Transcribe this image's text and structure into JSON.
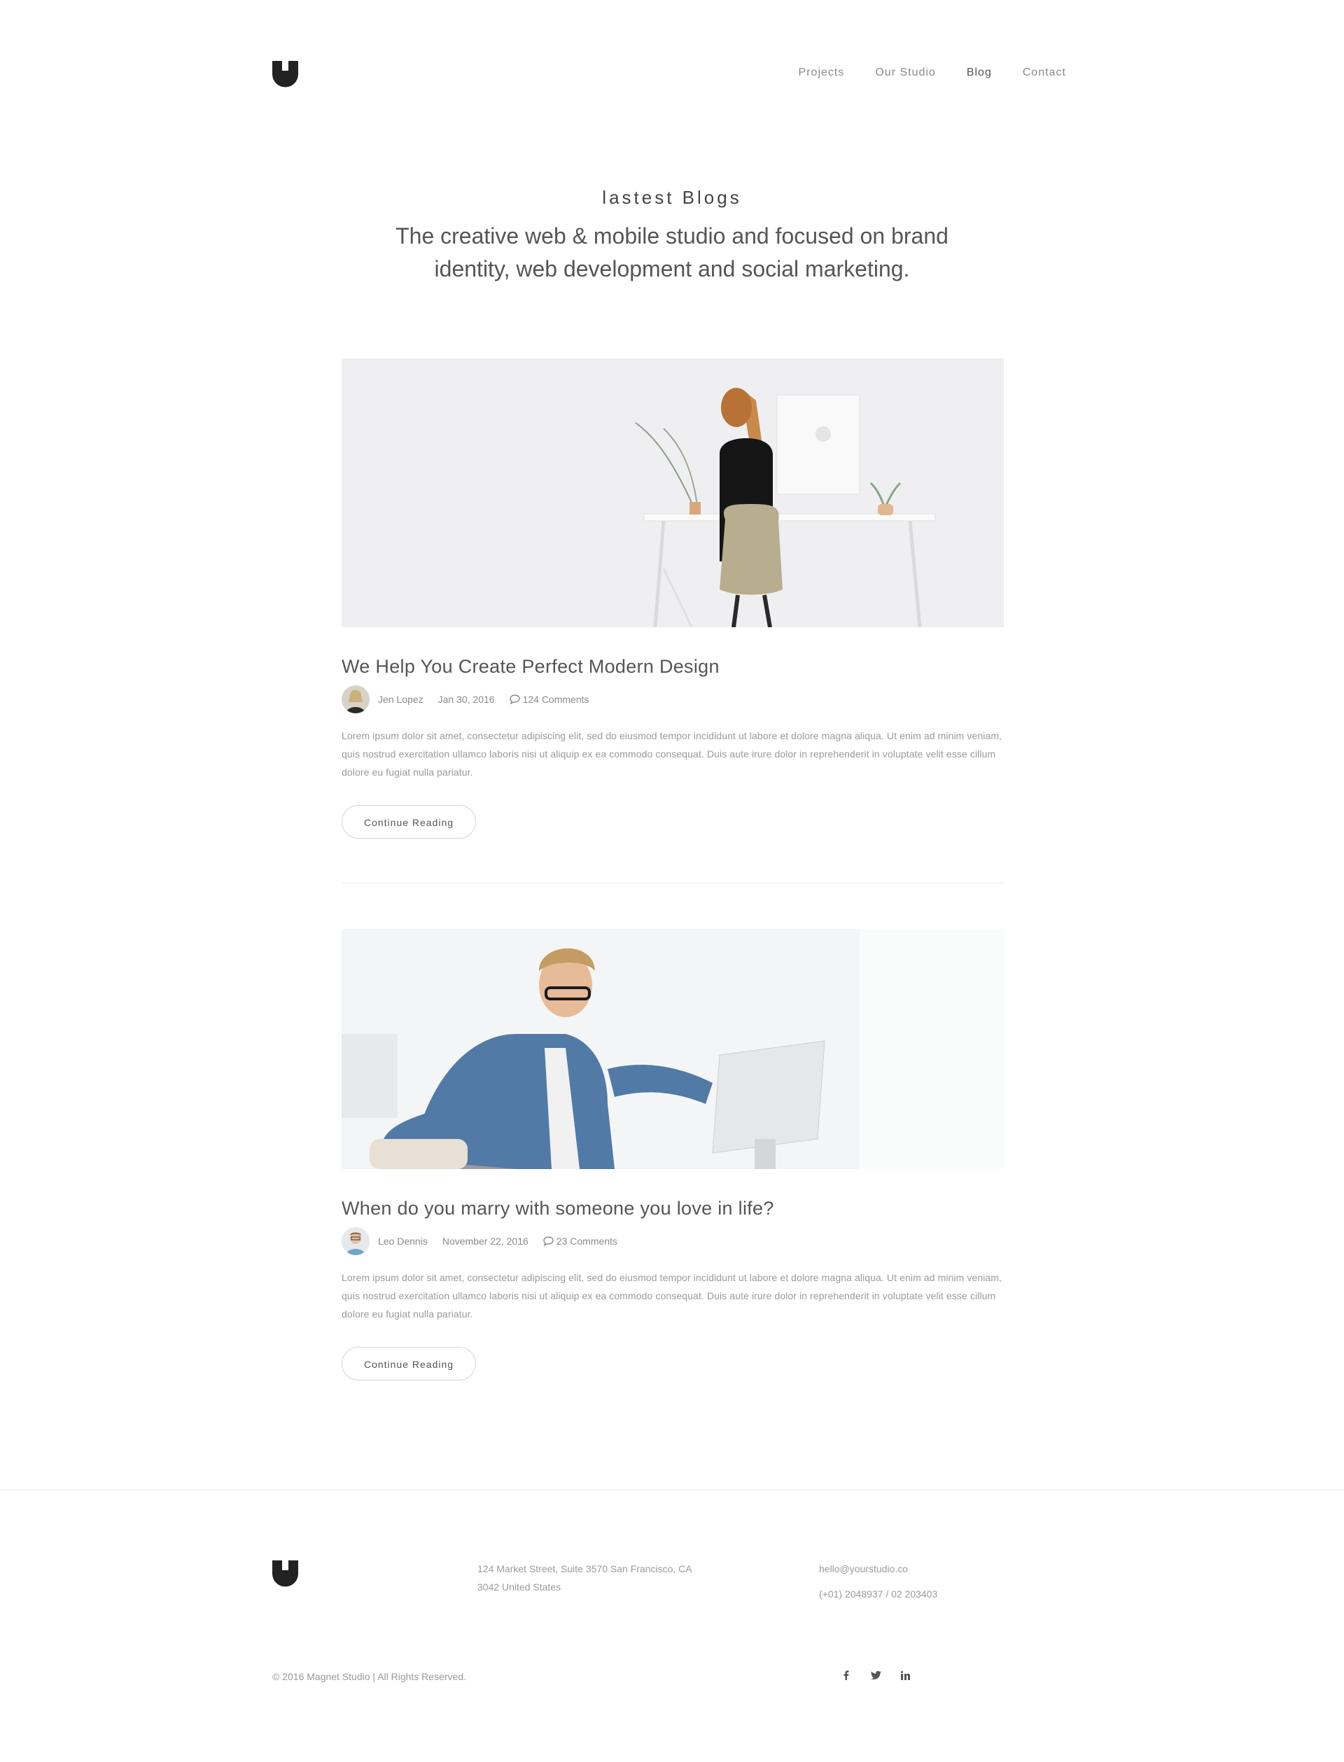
{
  "nav": {
    "items": [
      {
        "label": "Projects"
      },
      {
        "label": "Our Studio"
      },
      {
        "label": "Blog"
      },
      {
        "label": "Contact"
      }
    ]
  },
  "hero": {
    "kicker": "lastest Blogs",
    "subtitle": "The creative web & mobile studio and focused on brand identity, web development and social marketing."
  },
  "posts": [
    {
      "title": "We Help You Create Perfect Modern Design",
      "author": "Jen Lopez",
      "date": "Jan 30, 2016",
      "comments": "124 Comments",
      "excerpt": "Lorem ipsum dolor sit amet, consectetur adipiscing elit, sed do eiusmod tempor incididunt ut labore et dolore magna aliqua. Ut enim ad minim veniam, quis nostrud exercitation ullamco laboris nisi ut aliquip ex ea commodo consequat. Duis aute irure dolor in reprehenderit in voluptate velit esse cillum dolore eu fugiat nulla pariatur.",
      "button": "Continue Reading"
    },
    {
      "title": "When do you marry with someone you love in life?",
      "author": "Leo Dennis",
      "date": "November 22, 2016",
      "comments": "23 Comments",
      "excerpt": "Lorem ipsum dolor sit amet, consectetur adipiscing elit, sed do eiusmod tempor incididunt ut labore et dolore magna aliqua. Ut enim ad minim veniam, quis nostrud exercitation ullamco laboris nisi ut aliquip ex ea commodo consequat. Duis aute irure dolor in reprehenderit in voluptate velit esse cillum dolore eu fugiat nulla pariatur.",
      "button": "Continue Reading"
    }
  ],
  "footer": {
    "address_line1": "124 Market Street, Suite 3570 San Francisco, CA",
    "address_line2": "3042 United States",
    "email": "hello@yourstudio.co",
    "phone": "(+01) 2048937 / 02 203403",
    "copyright": "© 2016 Magnet Studio | All Rights Reserved.",
    "social": [
      "facebook-icon",
      "twitter-icon",
      "linkedin-icon"
    ]
  },
  "colors": {
    "text": "#555555",
    "muted": "#9a9a9a",
    "accent": "#222222"
  }
}
